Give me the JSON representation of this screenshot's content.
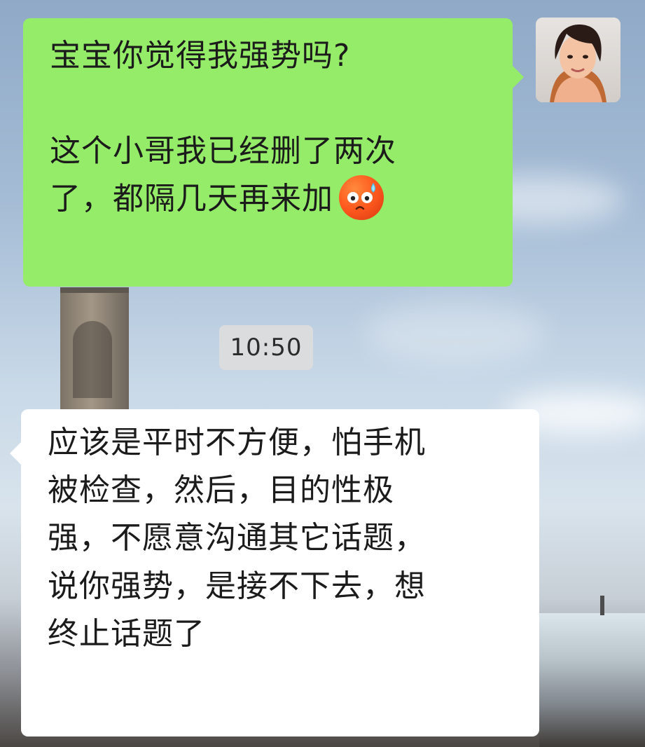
{
  "chat": {
    "outgoing": {
      "lines": [
        "宝宝你觉得我强势吗?",
        "",
        "这个小哥我已经删了两次",
        "了，都隔几天再来加"
      ],
      "emoji": "anxious-sweat-emoji"
    },
    "timestamp": "10:50",
    "incoming": {
      "lines": [
        "应该是平时不方便，怕手机",
        "被检查，然后，目的性极",
        "强，不愿意沟通其它话题，",
        "说你强势，是接不下去，想",
        "终止话题了"
      ]
    }
  },
  "colors": {
    "outgoing_bubble": "#95ec69",
    "incoming_bubble": "#ffffff",
    "timestamp_bg": "#dcdcdc"
  }
}
